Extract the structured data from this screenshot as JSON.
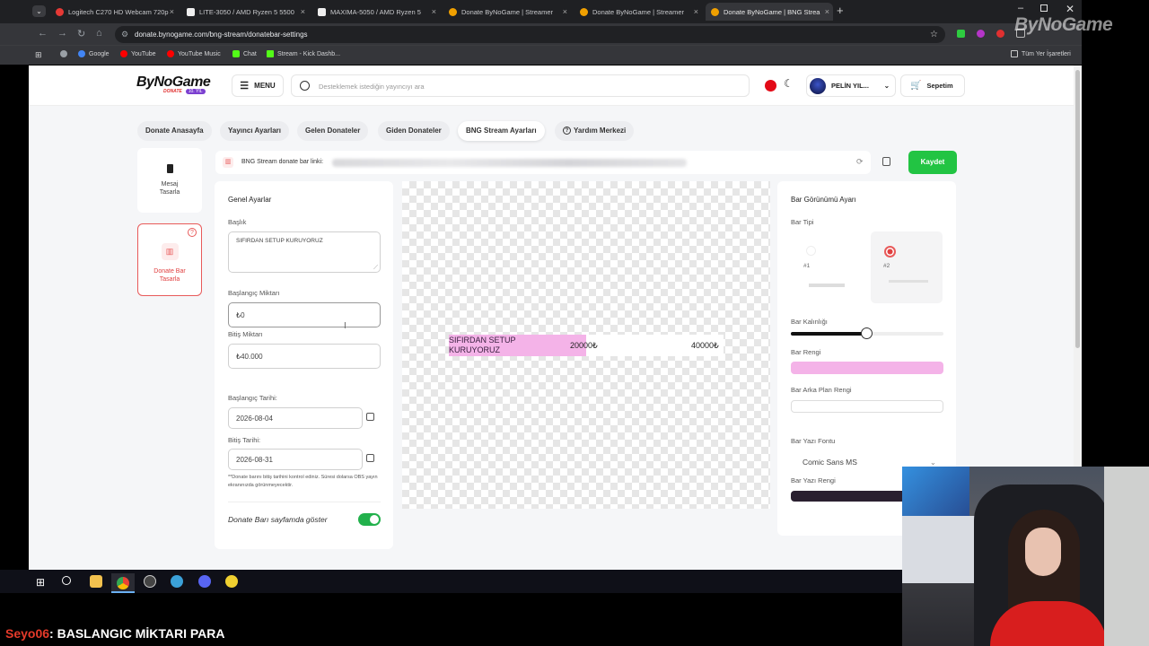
{
  "tabs": [
    {
      "label": "Logitech C270 HD Webcam 720p",
      "color": "#e53935"
    },
    {
      "label": "LITE-3050 / AMD Ryzen 5 5500",
      "color": "#f0f0f0"
    },
    {
      "label": "MAXIMA-5050 / AMD Ryzen 5",
      "color": "#f0f0f0"
    },
    {
      "label": "Donate ByNoGame | Streamer",
      "color": "#f0a000"
    },
    {
      "label": "Donate ByNoGame | Streamer",
      "color": "#f0a000"
    },
    {
      "label": "Donate ByNoGame | BNG Strea",
      "color": "#f0a000"
    }
  ],
  "address": {
    "url": "donate.bynogame.com/bng-stream/donatebar-settings"
  },
  "bookmarks": [
    {
      "label": "Google",
      "color": "#4285f4"
    },
    {
      "label": "YouTube",
      "color": "#ff0000"
    },
    {
      "label": "YouTube Music",
      "color": "#ff0000"
    },
    {
      "label": "Chat",
      "color": "#53fc18"
    },
    {
      "label": "Stream - Kick Dashb...",
      "color": "#53fc18"
    }
  ],
  "all_bookmarks": "Tüm Yer İşaretleri",
  "watermark": "ByNoGame",
  "header": {
    "logo": "ByNoGame",
    "logo_sub": "DONATE",
    "logo_badge": "10. YIL",
    "menu": "MENU",
    "search_placeholder": "Desteklemek istediğin yayıncıyı ara",
    "user": "PELİN YIL...",
    "cart": "Sepetim"
  },
  "nav": [
    "Donate Anasayfa",
    "Yayıncı Ayarları",
    "Gelen Donateler",
    "Giden Donateler",
    "BNG Stream Ayarları",
    "Yardım Merkezi"
  ],
  "side": {
    "item1": [
      "Mesaj",
      "Tasarla"
    ],
    "item2": [
      "Donate Bar",
      "Tasarla"
    ]
  },
  "linkbar": {
    "label": "BNG Stream donate bar linki:",
    "save": "Kaydet"
  },
  "general": {
    "title": "Genel Ayarlar",
    "baslik_label": "Başlık",
    "baslik_value": "SIFIRDAN SETUP KURUYORUZ",
    "start_label": "Başlangıç Miktarı",
    "start_value": "₺0",
    "end_label": "Bitiş Miktarı",
    "end_value": "₺40.000",
    "start_date_label": "Başlangıç Tarihi:",
    "start_date": "2026-08-04",
    "end_date_label": "Bitiş Tarihi:",
    "end_date": "2026-08-31",
    "note": "**Donate barını bitiş tarihini kontrol ediniz. Süresi dolarsa OBS yayın ekranınızda görünmeyecektir.",
    "toggle_label": "Donate Barı sayfamda göster"
  },
  "preview": {
    "title": "SIFIRDAN SETUP KURUYORUZ",
    "current": "20000₺",
    "target": "40000₺",
    "progress": 0.5
  },
  "appearance": {
    "title": "Bar Görünümü Ayarı",
    "type_label": "Bar Tipi",
    "type1": "#1",
    "type2": "#2",
    "thickness_label": "Bar Kalınlığı",
    "thickness": 0.5,
    "color_label": "Bar Rengi",
    "bar_color": "#f4b3e8",
    "bg_label": "Bar Arka Plan Rengi",
    "bg_color": "#ffffff",
    "font_label": "Bar Yazı Fontu",
    "font_value": "Comic Sans MS",
    "text_color_label": "Bar Yazı Rengi",
    "text_color": "#2a2030"
  },
  "chat": {
    "user": "Seyo06",
    "message": ": BASLANGIC MİKTARI PARA"
  }
}
